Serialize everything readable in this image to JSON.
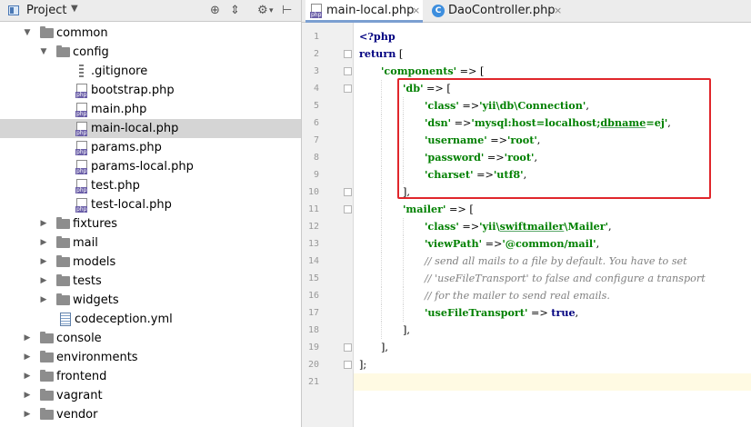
{
  "project_panel": {
    "title": "Project",
    "dropdown_icon": "triangle-down",
    "header_icons": [
      "target-icon",
      "collapse-all-icon",
      "settings-gear-icon",
      "pin-hide-icon"
    ],
    "tree": [
      {
        "label": "common",
        "type": "folder",
        "depth": 1,
        "expanded": true
      },
      {
        "label": "config",
        "type": "folder",
        "depth": 2,
        "expanded": true
      },
      {
        "label": ".gitignore",
        "type": "git",
        "depth": 3
      },
      {
        "label": "bootstrap.php",
        "type": "php",
        "depth": 3
      },
      {
        "label": "main.php",
        "type": "php",
        "depth": 3
      },
      {
        "label": "main-local.php",
        "type": "php",
        "depth": 3,
        "selected": true
      },
      {
        "label": "params.php",
        "type": "php",
        "depth": 3
      },
      {
        "label": "params-local.php",
        "type": "php",
        "depth": 3
      },
      {
        "label": "test.php",
        "type": "php",
        "depth": 3
      },
      {
        "label": "test-local.php",
        "type": "php",
        "depth": 3
      },
      {
        "label": "fixtures",
        "type": "folder",
        "depth": 2,
        "expanded": false
      },
      {
        "label": "mail",
        "type": "folder",
        "depth": 2,
        "expanded": false
      },
      {
        "label": "models",
        "type": "folder",
        "depth": 2,
        "expanded": false
      },
      {
        "label": "tests",
        "type": "folder",
        "depth": 2,
        "expanded": false
      },
      {
        "label": "widgets",
        "type": "folder",
        "depth": 2,
        "expanded": false
      },
      {
        "label": "codeception.yml",
        "type": "yml",
        "depth": 2
      },
      {
        "label": "console",
        "type": "folder",
        "depth": 1,
        "expanded": false
      },
      {
        "label": "environments",
        "type": "folder",
        "depth": 1,
        "expanded": false
      },
      {
        "label": "frontend",
        "type": "folder",
        "depth": 1,
        "expanded": false
      },
      {
        "label": "vagrant",
        "type": "folder",
        "depth": 1,
        "expanded": false
      },
      {
        "label": "vendor",
        "type": "folder",
        "depth": 1,
        "expanded": false
      }
    ]
  },
  "tabs": [
    {
      "label": "main-local.php",
      "icon": "php-file-icon",
      "active": true,
      "close": "×"
    },
    {
      "label": "DaoController.php",
      "icon": "class-file-icon",
      "icon_text": "C",
      "active": false,
      "close": "×"
    }
  ],
  "editor": {
    "current_line": 21,
    "lines": [
      {
        "n": "1",
        "indent": 0,
        "tokens": [
          [
            "kw",
            "<?php"
          ]
        ]
      },
      {
        "n": "2",
        "indent": 0,
        "fold": true,
        "tokens": [
          [
            "kw",
            "return"
          ],
          [
            "op",
            " ["
          ]
        ]
      },
      {
        "n": "3",
        "indent": 1,
        "fold": true,
        "tokens": [
          [
            "str",
            "'components'"
          ],
          [
            "op",
            " => ["
          ]
        ]
      },
      {
        "n": "4",
        "indent": 2,
        "fold": true,
        "tokens": [
          [
            "str",
            "'db'"
          ],
          [
            "op",
            " => ["
          ]
        ]
      },
      {
        "n": "5",
        "indent": 3,
        "tokens": [
          [
            "str",
            "'class'"
          ],
          [
            "op",
            " =>"
          ],
          [
            "str",
            "'yii\\db\\Connection'"
          ],
          [
            "op",
            ","
          ]
        ]
      },
      {
        "n": "6",
        "indent": 3,
        "tokens": [
          [
            "str",
            "'dsn'"
          ],
          [
            "op",
            " =>"
          ],
          [
            "str",
            "'mysql:host=localhost;"
          ],
          [
            "strU",
            "dbname"
          ],
          [
            "str",
            "=ej'"
          ],
          [
            "op",
            ","
          ]
        ]
      },
      {
        "n": "7",
        "indent": 3,
        "tokens": [
          [
            "str",
            "'username'"
          ],
          [
            "op",
            " =>"
          ],
          [
            "str",
            "'root'"
          ],
          [
            "op",
            ","
          ]
        ]
      },
      {
        "n": "8",
        "indent": 3,
        "tokens": [
          [
            "str",
            "'password'"
          ],
          [
            "op",
            " =>"
          ],
          [
            "str",
            "'root'"
          ],
          [
            "op",
            ","
          ]
        ]
      },
      {
        "n": "9",
        "indent": 3,
        "tokens": [
          [
            "str",
            "'charset'"
          ],
          [
            "op",
            " =>"
          ],
          [
            "str",
            "'utf8'"
          ],
          [
            "op",
            ","
          ]
        ]
      },
      {
        "n": "10",
        "indent": 2,
        "fold": true,
        "tokens": [
          [
            "op",
            "],"
          ]
        ]
      },
      {
        "n": "11",
        "indent": 2,
        "fold": true,
        "tokens": [
          [
            "str",
            "'mailer'"
          ],
          [
            "op",
            " => ["
          ]
        ]
      },
      {
        "n": "12",
        "indent": 3,
        "tokens": [
          [
            "str",
            "'class'"
          ],
          [
            "op",
            " =>"
          ],
          [
            "str",
            "'yii\\"
          ],
          [
            "strU",
            "swiftmailer"
          ],
          [
            "str",
            "\\Mailer'"
          ],
          [
            "op",
            ","
          ]
        ]
      },
      {
        "n": "13",
        "indent": 3,
        "tokens": [
          [
            "str",
            "'viewPath'"
          ],
          [
            "op",
            " =>"
          ],
          [
            "str",
            "'@common/mail'"
          ],
          [
            "op",
            ","
          ]
        ]
      },
      {
        "n": "14",
        "indent": 3,
        "tokens": [
          [
            "com",
            "// send all mails to a file by default. You have to set"
          ]
        ]
      },
      {
        "n": "15",
        "indent": 3,
        "tokens": [
          [
            "com",
            "// 'useFileTransport' to false and configure a transport"
          ]
        ]
      },
      {
        "n": "16",
        "indent": 3,
        "tokens": [
          [
            "com",
            "// for the mailer to send real emails."
          ]
        ]
      },
      {
        "n": "17",
        "indent": 3,
        "tokens": [
          [
            "str",
            "'useFileTransport'"
          ],
          [
            "op",
            " => "
          ],
          [
            "kw",
            "true"
          ],
          [
            "op",
            ","
          ]
        ]
      },
      {
        "n": "18",
        "indent": 2,
        "tokens": [
          [
            "op",
            "],"
          ]
        ]
      },
      {
        "n": "19",
        "indent": 1,
        "fold": true,
        "tokens": [
          [
            "op",
            "],"
          ]
        ]
      },
      {
        "n": "20",
        "indent": 0,
        "fold": true,
        "tokens": [
          [
            "op",
            "];"
          ]
        ]
      },
      {
        "n": "21",
        "indent": 0,
        "tokens": []
      }
    ]
  },
  "annotation": {
    "color": "#e0262b",
    "shape": "rectangle-outline",
    "encloses": "db config lines 4-10"
  }
}
